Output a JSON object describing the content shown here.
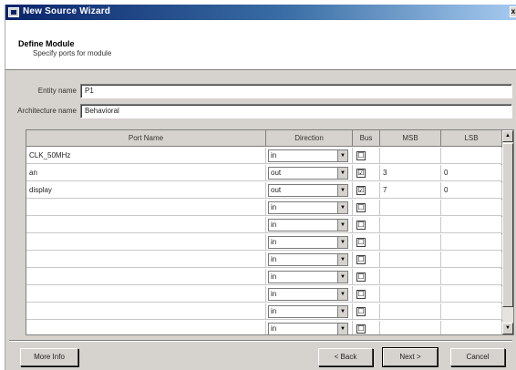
{
  "window": {
    "title": "New Source Wizard",
    "close_label": "x"
  },
  "header": {
    "title": "Define Module",
    "subtitle": "Specify ports for module"
  },
  "form": {
    "entity_label": "Entity name",
    "entity_value": "P1",
    "architecture_label": "Architecture name",
    "architecture_value": "Behavioral"
  },
  "grid": {
    "columns": [
      "Port Name",
      "Direction",
      "Bus",
      "MSB",
      "LSB"
    ],
    "rows": [
      {
        "port": "CLK_50MHz",
        "direction": "in",
        "bus": "☐",
        "msb": "",
        "lsb": ""
      },
      {
        "port": "an",
        "direction": "out",
        "bus": "☑",
        "msb": "3",
        "lsb": "0"
      },
      {
        "port": "display",
        "direction": "out",
        "bus": "☑",
        "msb": "7",
        "lsb": "0"
      },
      {
        "port": "",
        "direction": "in",
        "bus": "☐",
        "msb": "",
        "lsb": ""
      },
      {
        "port": "",
        "direction": "in",
        "bus": "☐",
        "msb": "",
        "lsb": ""
      },
      {
        "port": "",
        "direction": "in",
        "bus": "☐",
        "msb": "",
        "lsb": ""
      },
      {
        "port": "",
        "direction": "in",
        "bus": "☐",
        "msb": "",
        "lsb": ""
      },
      {
        "port": "",
        "direction": "in",
        "bus": "☐",
        "msb": "",
        "lsb": ""
      },
      {
        "port": "",
        "direction": "in",
        "bus": "☐",
        "msb": "",
        "lsb": ""
      },
      {
        "port": "",
        "direction": "in",
        "bus": "☐",
        "msb": "",
        "lsb": ""
      },
      {
        "port": "",
        "direction": "in",
        "bus": "☐",
        "msb": "",
        "lsb": ""
      }
    ],
    "dropdown_glyph": "▼",
    "scroll_up_glyph": "▲",
    "scroll_down_glyph": "▼"
  },
  "buttons": {
    "more_info": "More Info",
    "back": "< Back",
    "next": "Next >",
    "cancel": "Cancel"
  },
  "colors": {
    "titlebar": "#0a246a",
    "dialog": "#d6d3ce"
  }
}
